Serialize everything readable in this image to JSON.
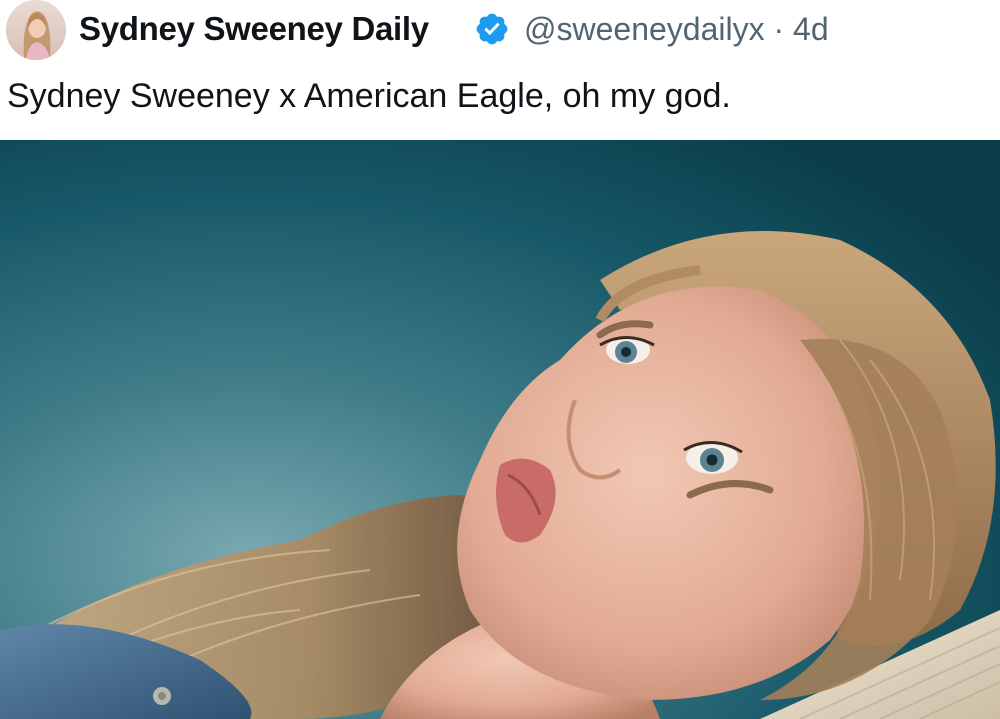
{
  "post": {
    "author": {
      "display_name": "Sydney Sweeney Daily",
      "handle": "@sweeneydailyx",
      "verified": true
    },
    "separator": "·",
    "time": "4d",
    "text": "Sydney Sweeney x American Eagle, oh my god.",
    "media": {
      "kind": "photo",
      "alt": ""
    }
  },
  "colors": {
    "verified_badge": "#1d9bf0",
    "secondary_text": "#536471",
    "primary_text": "#0f1419",
    "media_background": "#0f4a55"
  },
  "icons": {
    "verified": "verified-badge-icon"
  }
}
